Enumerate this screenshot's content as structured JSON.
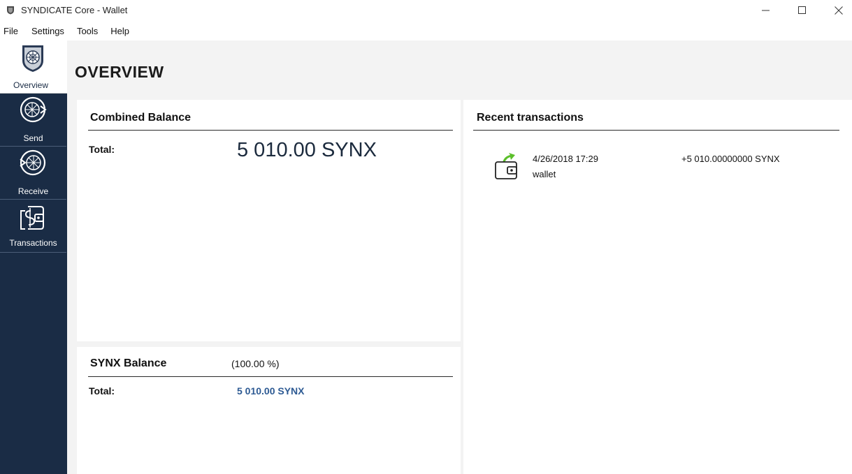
{
  "window": {
    "title": "SYNDICATE Core - Wallet"
  },
  "menu": [
    "File",
    "Settings",
    "Tools",
    "Help"
  ],
  "sidebar": {
    "items": [
      {
        "label": "Overview",
        "icon": "shield-globe-icon",
        "active": true
      },
      {
        "label": "Send",
        "icon": "send-globe-icon",
        "active": false
      },
      {
        "label": "Receive",
        "icon": "receive-globe-icon",
        "active": false
      },
      {
        "label": "Transactions",
        "icon": "transactions-wallet-icon",
        "active": false
      }
    ]
  },
  "page": {
    "title": "OVERVIEW"
  },
  "combined": {
    "heading": "Combined Balance",
    "total_label": "Total:",
    "total_value": "5 010.00 SYNX"
  },
  "synx": {
    "heading": "SYNX Balance",
    "percent": "(100.00 %)",
    "total_label": "Total:",
    "total_value": "5 010.00 SYNX"
  },
  "recent": {
    "heading": "Recent transactions",
    "transactions": [
      {
        "date": "4/26/2018 17:29",
        "label": "wallet",
        "amount": "+5 010.00000000 SYNX",
        "icon": "incoming-wallet-icon"
      }
    ]
  },
  "colors": {
    "sidebar_bg": "#1a2c45",
    "accent_blue": "#2d5a93",
    "incoming_green": "#5bbf2a"
  }
}
